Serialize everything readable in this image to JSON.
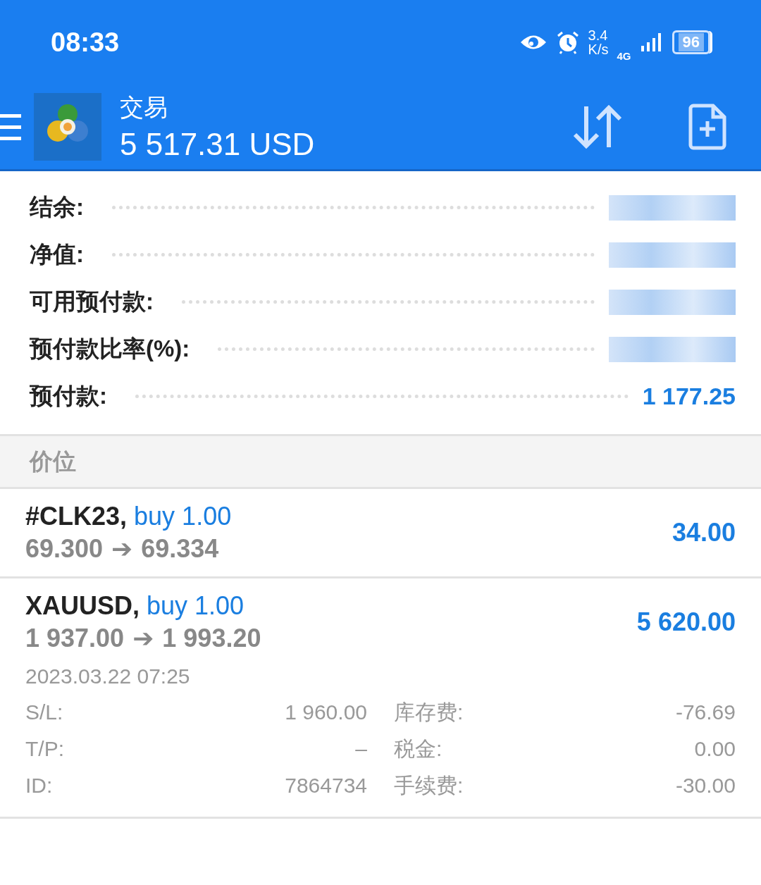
{
  "status_bar": {
    "time": "08:33",
    "speed_value": "3.4",
    "speed_unit": "K/s",
    "network": "4G",
    "battery": "96"
  },
  "header": {
    "title": "交易",
    "balance": "5 517.31 USD"
  },
  "summary": [
    {
      "label": "结余:",
      "redacted": true
    },
    {
      "label": "净值:",
      "redacted": true
    },
    {
      "label": "可用预付款:",
      "redacted": true
    },
    {
      "label": "预付款比率(%):",
      "redacted": true
    },
    {
      "label": "预付款:",
      "redacted": false,
      "value": "1 177.25"
    }
  ],
  "section": {
    "title": "价位"
  },
  "positions": [
    {
      "symbol": "#CLK23,",
      "side": "buy 1.00",
      "open": "69.300",
      "arrow": "➔",
      "current": "69.334",
      "profit": "34.00",
      "expanded": false
    },
    {
      "symbol": "XAUUSD,",
      "side": "buy 1.00",
      "open": "1 937.00",
      "arrow": "➔",
      "current": "1 993.20",
      "profit": "5 620.00",
      "expanded": true,
      "time": "2023.03.22 07:25",
      "details": [
        {
          "label": "S/L:",
          "value": "1 960.00"
        },
        {
          "label": "库存费:",
          "value": "-76.69"
        },
        {
          "label": "T/P:",
          "value": "–"
        },
        {
          "label": "税金:",
          "value": "0.00"
        },
        {
          "label": "ID:",
          "value": "7864734"
        },
        {
          "label": "手续费:",
          "value": "-30.00"
        }
      ]
    }
  ]
}
